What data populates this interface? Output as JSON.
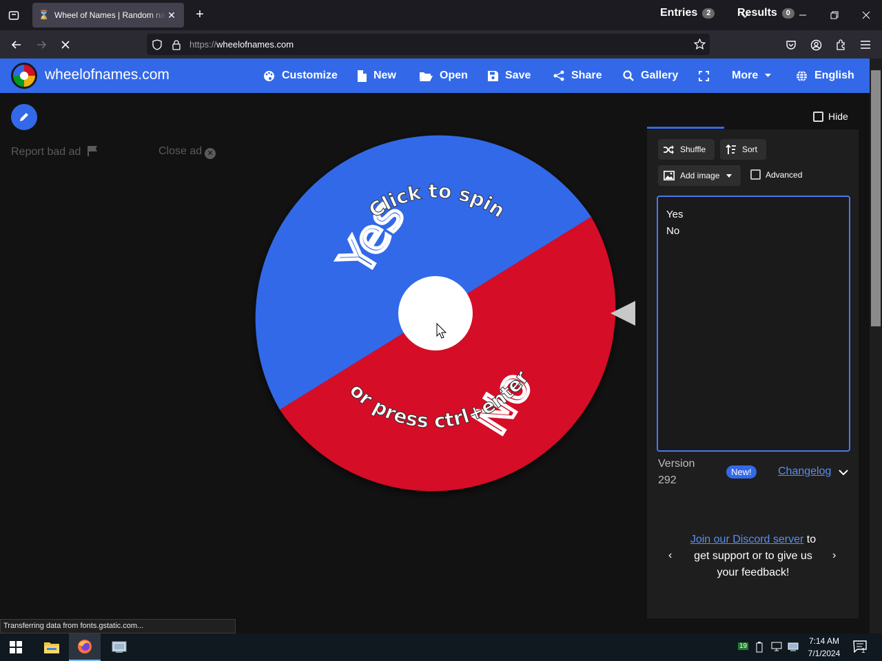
{
  "browser": {
    "tab_title": "Wheel of Names | Random name picker",
    "url_protocol": "https://",
    "url_host": "wheelofnames.com",
    "status_text": "Transferring data from fonts.gstatic.com..."
  },
  "site": {
    "name": "wheelofnames.com",
    "menu": {
      "customize": "Customize",
      "new": "New",
      "open": "Open",
      "save": "Save",
      "share": "Share",
      "gallery": "Gallery",
      "more": "More",
      "language": "English"
    },
    "brand_color": "#3369e8"
  },
  "ads": {
    "report": "Report bad ad",
    "close": "Close ad"
  },
  "wheel": {
    "segments": [
      {
        "label": "Yes",
        "color": "#3369e8"
      },
      {
        "label": "No",
        "color": "#d50f25"
      }
    ],
    "prompt_top": "Click to spin",
    "prompt_bottom": "or press ctrl+enter"
  },
  "panel": {
    "tab_entries": "Entries",
    "entries_count": "2",
    "tab_results": "Results",
    "results_count": "0",
    "hide_label": "Hide",
    "shuffle": "Shuffle",
    "sort": "Sort",
    "add_image": "Add image",
    "advanced": "Advanced",
    "entries": [
      "Yes",
      "No"
    ],
    "version_label": "Version",
    "version_number": "292",
    "new_badge": "New!",
    "changelog": "Changelog",
    "discord_link": "Join our Discord server",
    "discord_rest_1": " to",
    "discord_rest_2": "get support or to give us your feedback!"
  },
  "taskbar": {
    "time": "7:14 AM",
    "date": "7/1/2024",
    "notification_count": "1",
    "tray_badge": "19"
  }
}
